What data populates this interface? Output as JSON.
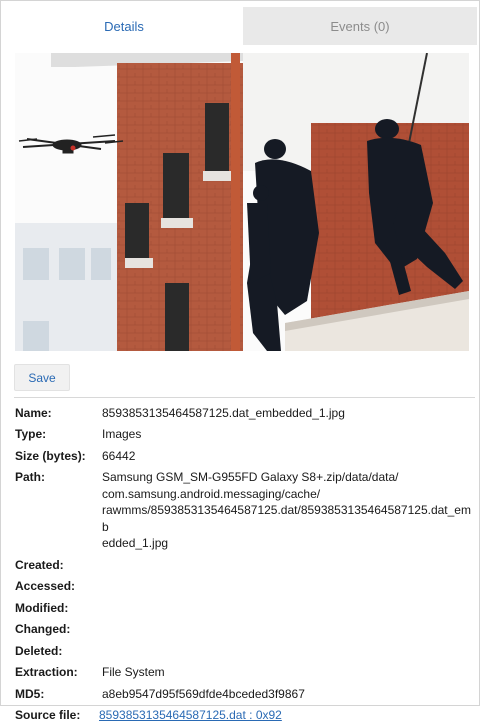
{
  "tabs": [
    {
      "label": "Details",
      "active": true
    },
    {
      "label": "Events (0)",
      "active": false
    }
  ],
  "image": {
    "description_icon": "photo-preview"
  },
  "save_label": "Save",
  "properties": [
    {
      "label": "Name:",
      "value": "8593853135464587125.dat_embedded_1.jpg"
    },
    {
      "label": "Type:",
      "value": "Images"
    },
    {
      "label": "Size (bytes):",
      "value": "66442"
    },
    {
      "label": "Path:",
      "value": "Samsung GSM_SM-G955FD Galaxy S8+.zip/data/data/\ncom.samsung.android.messaging/cache/\nrawmms/8593853135464587125.dat/8593853135464587125.dat_emb\nedded_1.jpg"
    },
    {
      "label": "Created:",
      "value": ""
    },
    {
      "label": "Accessed:",
      "value": ""
    },
    {
      "label": "Modified:",
      "value": ""
    },
    {
      "label": "Changed:",
      "value": ""
    },
    {
      "label": "Deleted:",
      "value": ""
    },
    {
      "label": "Extraction:",
      "value": "File System"
    },
    {
      "label": "MD5:",
      "value": "a8eb9547d95f569dfde4bceded3f9867"
    }
  ],
  "source_file": {
    "label": "Source file:",
    "value": "8593853135464587125.dat : 0x92"
  },
  "colors": {
    "accent": "#2a6ab4",
    "tab_inactive_text": "#8c8c8c"
  }
}
